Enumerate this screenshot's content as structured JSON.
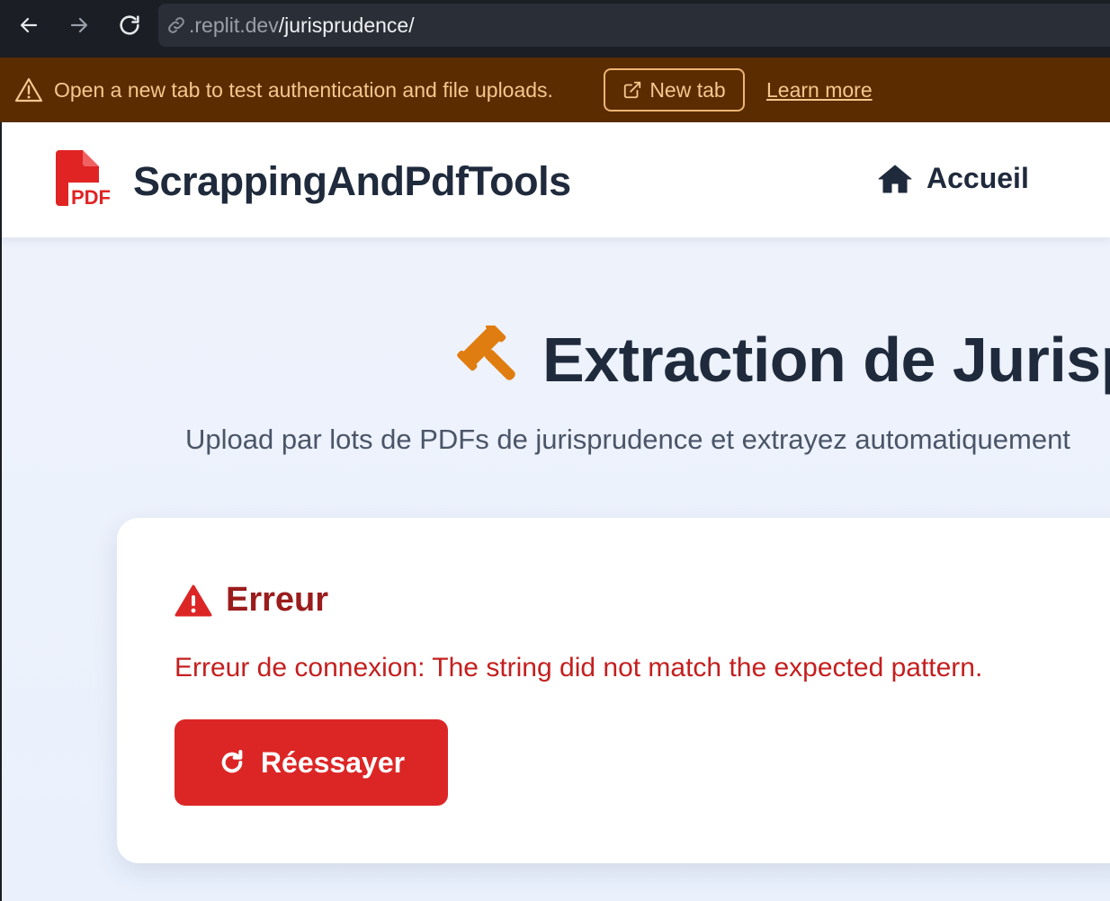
{
  "browser": {
    "url_host": ".replit.dev",
    "url_path": "/jurisprudence/",
    "icons": [
      "back-arrow-icon",
      "forward-arrow-icon",
      "reload-icon",
      "link-icon"
    ]
  },
  "banner": {
    "message": "Open a new tab to test authentication and file uploads.",
    "new_tab_label": "New tab",
    "learn_more_label": "Learn more",
    "background_color": "#5a2c00",
    "text_color": "#f5c78e"
  },
  "header": {
    "brand_name": "ScrappingAndPdfTools",
    "brand_icon_text": "PDF",
    "nav": [
      {
        "label": "Accueil",
        "icon": "home-icon"
      }
    ]
  },
  "main": {
    "title": "Extraction de Jurisp",
    "title_icon": "gavel-icon",
    "subtitle": "Upload par lots de PDFs de jurisprudence et extrayez automatiquement"
  },
  "error_card": {
    "title": "Erreur",
    "message": "Erreur de connexion: The string did not match the expected pattern.",
    "retry_label": "Réessayer",
    "accent_color": "#dc2626"
  }
}
